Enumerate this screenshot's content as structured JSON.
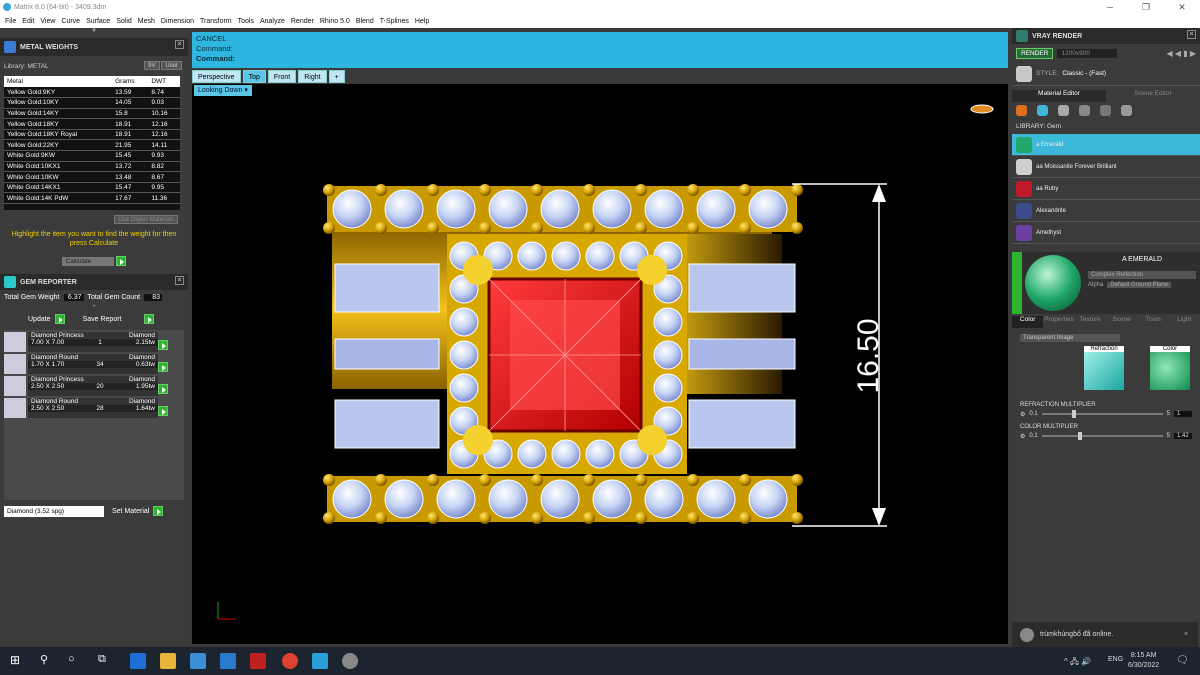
{
  "window": {
    "title": "Matrix 8.0 (64-bit) - 3409.3dm"
  },
  "menu": [
    "File",
    "Edit",
    "View",
    "Curve",
    "Surface",
    "Solid",
    "Mesh",
    "Dimension",
    "Transform",
    "Tools",
    "Analyze",
    "Render",
    "Rhino 5.0",
    "Blend",
    "T-Splines",
    "Help"
  ],
  "metal_weights": {
    "title": "METAL WEIGHTS",
    "library_label": "Library: METAL",
    "lib_btn1": "9V",
    "lib_btn2": "User",
    "columns": [
      "Metal",
      "Grams",
      "DWT"
    ],
    "rows": [
      [
        "Yellow Gold:9KY",
        "13.59",
        "8.74"
      ],
      [
        "Yellow Gold:10KY",
        "14.05",
        "9.03"
      ],
      [
        "Yellow Gold:14KY",
        "15.8",
        "10.16"
      ],
      [
        "Yellow Gold:18KY",
        "18.91",
        "12.16"
      ],
      [
        "Yellow Gold:18KY Royal",
        "18.91",
        "12.16"
      ],
      [
        "Yellow Gold:22KY",
        "21.95",
        "14.11"
      ],
      [
        "White Gold:9KW",
        "15.45",
        "9.93"
      ],
      [
        "White Gold:10KX1",
        "13.72",
        "8.82"
      ],
      [
        "White Gold:10KW",
        "13.48",
        "8.67"
      ],
      [
        "White Gold:14KX1",
        "15.47",
        "9.95"
      ],
      [
        "White Gold:14K PdW",
        "17.67",
        "11.36"
      ]
    ],
    "use_object_materials": "Use Object Materials",
    "hint": "Highlight the item you want to find the weight for then press Calculate",
    "calculate": "Calculate"
  },
  "gem_reporter": {
    "title": "GEM REPORTER",
    "total_weight_label": "Total Gem Weight",
    "total_weight": "6.37",
    "total_count_label": "Total Gem Count",
    "total_count": "83",
    "update": "Update",
    "save_report": "Save Report",
    "gems": [
      {
        "cut": "Diamond Princess",
        "type": "Diamond",
        "size": "7.00 X 7.00",
        "qty": "1",
        "ctw": "2.15tw"
      },
      {
        "cut": "Diamond Round",
        "type": "Diamond",
        "size": "1.70 X 1.70",
        "qty": "34",
        "ctw": "0.63tw"
      },
      {
        "cut": "Diamond Princess",
        "type": "Diamond",
        "size": "2.50 X 2.50",
        "qty": "20",
        "ctw": "1.95tw"
      },
      {
        "cut": "Diamond Round",
        "type": "Diamond",
        "size": "2.50 X 2.50",
        "qty": "28",
        "ctw": "1.64tw"
      }
    ],
    "material_select": "Diamond   (3.52 spg)",
    "set_material": "Set Material"
  },
  "command": {
    "line1": "CANCEL",
    "line2": "Command:",
    "line3": "Command:"
  },
  "view_tabs": [
    "Perspective",
    "Top",
    "Front",
    "Right",
    "+"
  ],
  "looking_down": "Looking Down",
  "dimension_label": "16.50",
  "vray": {
    "title": "VRAY RENDER",
    "render": "RENDER",
    "resolution": "1200x900",
    "style_label": "STYLE:",
    "style_value": "Classic - (Fast)",
    "tab_material": "Material Editor",
    "tab_scene": "Scene Editor",
    "library_label": "LIBRARY: Gem",
    "materials": [
      {
        "name": "a Emerald",
        "color": "#1fa86a"
      },
      {
        "name": "aa Moissanite Forever Brilliant",
        "color": "#cfcfcf"
      },
      {
        "name": "aa Ruby",
        "color": "#c01a2a"
      },
      {
        "name": "Alexandrite",
        "color": "#3b4a8a"
      },
      {
        "name": "Amethyst",
        "color": "#6a3fa0"
      }
    ],
    "selected_name": "A EMERALD",
    "complex": "Complex Reflection",
    "alpha": "Alpha",
    "ground": "Default Ground Plane",
    "sub_tabs": [
      "Color",
      "Properties",
      "Texture",
      "Scene",
      "Tison",
      "Light"
    ],
    "transparent": "Transparent Image",
    "refraction": "Refraction",
    "color": "Color",
    "refr_mult_label": "REFRACTION MULTIPLIER",
    "refr_min": "0.1",
    "refr_max": "5",
    "refr_value": "1",
    "color_mult_label": "COLOR MULTIPLIER",
    "color_min": "0.1",
    "color_max": "5",
    "color_value": "1.42"
  },
  "notification": {
    "text": "trùmkhùngbố đã online."
  },
  "taskbar": {
    "lang": "ENG",
    "time": "8:15 AM",
    "date": "6/30/2022"
  }
}
